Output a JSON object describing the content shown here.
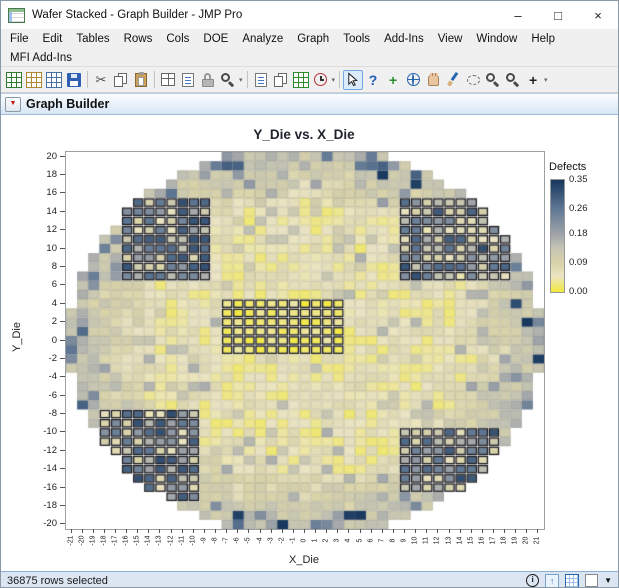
{
  "window": {
    "title": "Wafer Stacked - Graph Builder - JMP Pro",
    "minimize": "–",
    "maximize": "□",
    "close": "×"
  },
  "menubar": {
    "items": [
      "File",
      "Edit",
      "Tables",
      "Rows",
      "Cols",
      "DOE",
      "Analyze",
      "Graph",
      "Tools",
      "Add-Ins",
      "View",
      "Window",
      "Help"
    ]
  },
  "addins_bar": {
    "items": [
      "MFI Add-Ins"
    ]
  },
  "toolbar": {
    "buttons": [
      {
        "name": "new-data-table",
        "cls": "ic-grid",
        "color": "#2e7d32"
      },
      {
        "name": "open-table",
        "cls": "ic-grid",
        "color": "#b08830"
      },
      {
        "name": "database-query",
        "cls": "ic-grid",
        "color": "#4a6fa5"
      },
      {
        "name": "save",
        "cls": "ic-floppy"
      },
      {
        "sep": true
      },
      {
        "name": "cut",
        "glyph": "✂",
        "color": "#4a4a4a"
      },
      {
        "name": "copy",
        "cls": "ic-copy"
      },
      {
        "name": "paste",
        "cls": "ic-paste"
      },
      {
        "sep": true
      },
      {
        "name": "summary-table",
        "cls": "ic-layout"
      },
      {
        "name": "journal",
        "cls": "ic-journal"
      },
      {
        "name": "lock",
        "cls": "ic-lock"
      },
      {
        "name": "search",
        "cls": "ic-mag"
      },
      {
        "overflow": true,
        "glyph": "▾"
      },
      {
        "sep": true
      },
      {
        "name": "new-journal-page",
        "cls": "ic-journal"
      },
      {
        "name": "copy-document",
        "cls": "ic-copy"
      },
      {
        "name": "update-table",
        "cls": "ic-grid",
        "color": "#2e8b2e"
      },
      {
        "name": "recent-files",
        "cls": "ic-clock"
      },
      {
        "overflow": true,
        "glyph": "▾"
      },
      {
        "sep": true
      },
      {
        "name": "arrow-tool",
        "cls": "ic-cursor",
        "active": true
      },
      {
        "name": "help-tool",
        "glyph": "?",
        "color": "#1f5bb5",
        "bold": true
      },
      {
        "name": "crosshair-tool",
        "glyph": "+",
        "color": "#2e8b2e",
        "bold": true
      },
      {
        "name": "globe-tool",
        "cls": "ic-globe"
      },
      {
        "name": "grabber-tool",
        "cls": "ic-hand"
      },
      {
        "name": "brush-tool",
        "cls": "ic-brush"
      },
      {
        "name": "lasso-tool",
        "cls": "ic-lasso"
      },
      {
        "name": "zoom-out-tool",
        "cls": "ic-mag"
      },
      {
        "name": "zoom-in-tool",
        "cls": "ic-mag"
      },
      {
        "name": "plus-tool",
        "glyph": "+",
        "color": "#222222",
        "bold": true
      },
      {
        "overflow": true,
        "glyph": "▾"
      }
    ]
  },
  "panel": {
    "title": "Graph Builder",
    "disclosure": "▼"
  },
  "chart_data": {
    "type": "heatmap",
    "title": "Y_Die vs. X_Die",
    "xlabel": "X_Die",
    "ylabel": "Y_Die",
    "x_range": [
      -21,
      21
    ],
    "y_range": [
      -20,
      20
    ],
    "x_ticks": [
      -21,
      -20,
      -19,
      -18,
      -17,
      -16,
      -15,
      -14,
      -13,
      -12,
      -11,
      -10,
      -9,
      -8,
      -7,
      -6,
      -5,
      -4,
      -3,
      -2,
      -1,
      0,
      1,
      2,
      3,
      4,
      5,
      6,
      7,
      8,
      9,
      10,
      11,
      12,
      13,
      14,
      15,
      16,
      17,
      18,
      19,
      20,
      21
    ],
    "y_ticks": [
      20,
      18,
      16,
      14,
      12,
      10,
      8,
      6,
      4,
      2,
      0,
      -2,
      -4,
      -6,
      -8,
      -10,
      -12,
      -14,
      -16,
      -18,
      -20
    ],
    "wafer_radius": 21.35,
    "legend": {
      "title": "Defects",
      "max": 0.35,
      "ticks": [
        "0.35",
        "0.26",
        "0.18",
        "0.09",
        "0.00"
      ],
      "stops": [
        {
          "v": 0.0,
          "c": "#f3e93c"
        },
        {
          "v": 0.05,
          "c": "#eae4c4"
        },
        {
          "v": 0.09,
          "c": "#d9d3a9"
        },
        {
          "v": 0.14,
          "c": "#c3c3b3"
        },
        {
          "v": 0.18,
          "c": "#a0a4a9"
        },
        {
          "v": 0.26,
          "c": "#5e7794"
        },
        {
          "v": 0.35,
          "c": "#17375e"
        }
      ]
    },
    "selected_regions": [
      {
        "kind": "corner",
        "x1": -16,
        "x2": -9,
        "y1": 7,
        "y2": 15
      },
      {
        "kind": "corner",
        "x1": 9,
        "x2": 18,
        "y1": 7,
        "y2": 15
      },
      {
        "kind": "center",
        "x1": -7,
        "x2": 3,
        "y1": -1,
        "y2": 4
      },
      {
        "kind": "corner",
        "x1": -18,
        "x2": -10,
        "y1": -17,
        "y2": -8
      },
      {
        "kind": "corner",
        "x1": 9,
        "x2": 17,
        "y1": -16,
        "y2": -10
      }
    ],
    "value_model": {
      "base_min": 0.02,
      "base_range": 0.06,
      "patch_chance": 0.12,
      "patch_min": 0.1,
      "patch_range": 0.07,
      "edge_start_radius": 15,
      "edge_slope": 0.013,
      "edge_noise": 0.03,
      "rim_radius": 19.3,
      "rim_blue_chance": 0.2,
      "rim_blue_min": 0.22,
      "rim_blue_range": 0.13,
      "corner_sel_min": 0.04,
      "corner_sel_range": 0.28,
      "center_sel_min": 0.0,
      "center_sel_range": 0.04
    }
  },
  "statusbar": {
    "text": "36875 rows selected",
    "icons": [
      {
        "name": "status-info-icon",
        "kind": "info",
        "glyph": "i"
      },
      {
        "name": "status-up-arrow-icon",
        "kind": "up",
        "glyph": "↑"
      },
      {
        "name": "status-grid-icon",
        "kind": "grid"
      },
      {
        "name": "status-swatch-icon",
        "kind": "swatch"
      },
      {
        "name": "status-dropdown-icon",
        "kind": "drop",
        "glyph": "▼"
      }
    ]
  }
}
